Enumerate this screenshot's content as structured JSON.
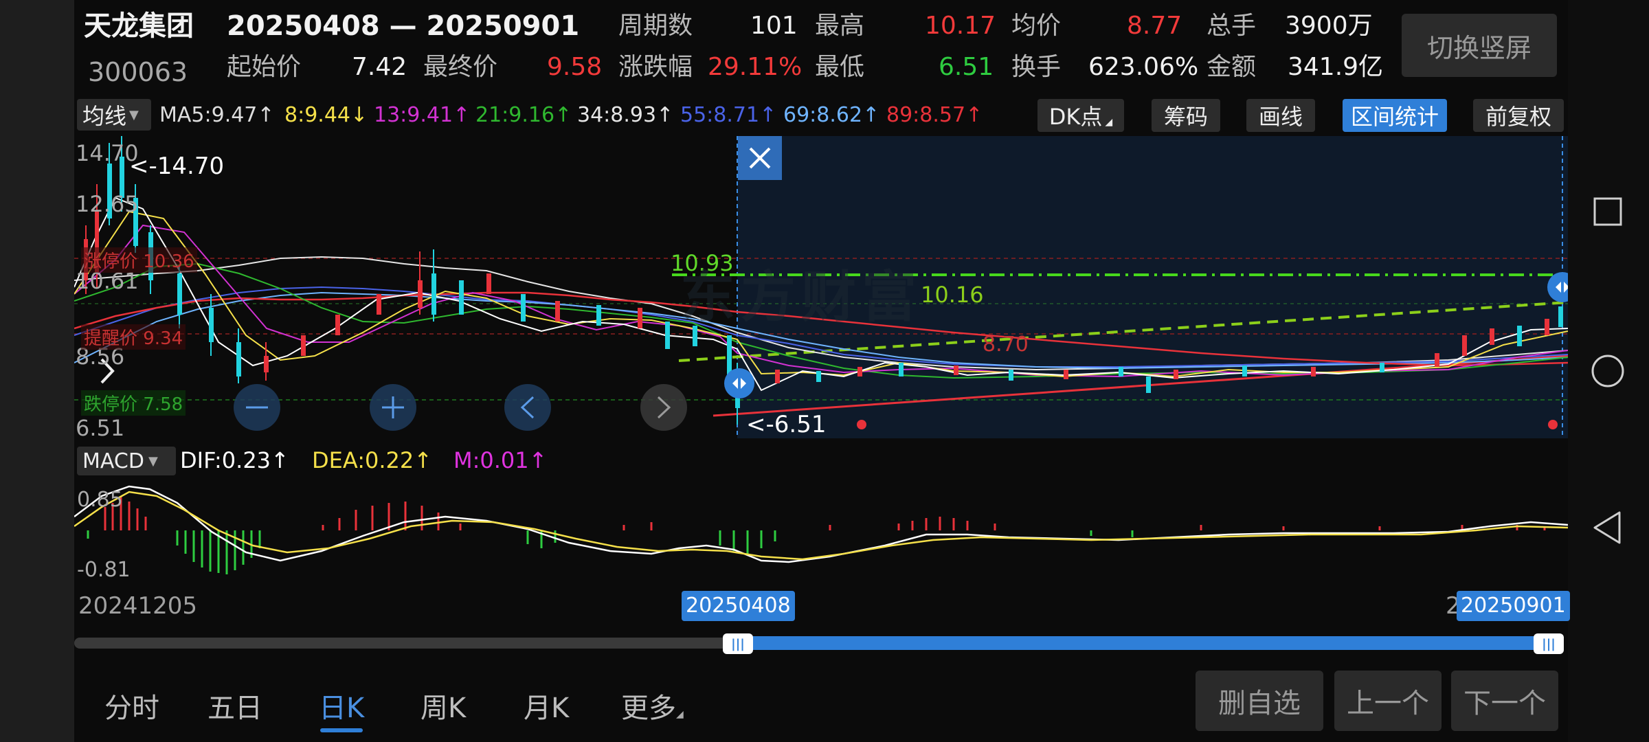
{
  "header": {
    "stock_name": "天龙集团",
    "date_range": "20250408 — 20250901",
    "stock_code": "300063",
    "stats_row1": [
      {
        "label": "周期数",
        "value": "101"
      },
      {
        "label": "最高",
        "value": "10.17"
      },
      {
        "label": "均价",
        "value": "8.77"
      },
      {
        "label": "总手",
        "value": "3900万"
      }
    ],
    "stats_row2": [
      {
        "label": "起始价",
        "value": "7.42"
      },
      {
        "label": "最终价",
        "value": "9.58"
      },
      {
        "label": "涨跌幅",
        "value": "29.11%"
      },
      {
        "label": "最低",
        "value": "6.51"
      },
      {
        "label": "换手",
        "value": "623.06%"
      },
      {
        "label": "金额",
        "value": "341.9亿"
      }
    ],
    "switch_button": "切换竖屏"
  },
  "toolbar": {
    "indicator_select": "均线",
    "ma_items": [
      {
        "text": "MA5:9.47↑",
        "color": "#ffffff"
      },
      {
        "text": "8:9.44↓",
        "color": "#f5e04a"
      },
      {
        "text": "13:9.41↑",
        "color": "#d232d2"
      },
      {
        "text": "21:9.16↑",
        "color": "#2fb82f"
      },
      {
        "text": "34:8.93↑",
        "color": "#e6e6e6"
      },
      {
        "text": "55:8.71↑",
        "color": "#4a63e8"
      },
      {
        "text": "69:8.62↑",
        "color": "#6fb4ff"
      },
      {
        "text": "89:8.57↑",
        "color": "#e8323a"
      }
    ],
    "buttons": [
      "DK点",
      "筹码",
      "画线",
      "区间统计",
      "前复权"
    ]
  },
  "price_chart": {
    "y_labels": [
      "14.70",
      "12.65",
      "10.61",
      "8.56",
      "6.51"
    ],
    "high_marker": "<-14.70",
    "low_marker": "<-6.51",
    "limit_up_label": "涨停价 10.36",
    "reminder_label": "提醒价 9.34",
    "limit_down_label": "跌停价 7.58",
    "line_label_1": "10.93",
    "line_label_2": "10.16",
    "line_label_3": "8.70",
    "watermark": "东方财富",
    "close_icon": "×"
  },
  "macd": {
    "selector": "MACD",
    "dif": "DIF:0.23↑",
    "dea": "DEA:0.22↑",
    "m": "M:0.01↑",
    "y_top": "0.85",
    "y_bottom": "-0.81"
  },
  "range_slider": {
    "start_date": "20241205",
    "sel_start": "20250408",
    "sel_end": "20250901",
    "end_partial": "2"
  },
  "bottom_tabs": [
    "分时",
    "五日",
    "日K",
    "周K",
    "月K",
    "更多"
  ],
  "bottom_buttons": [
    "删自选",
    "上一个",
    "下一个"
  ],
  "colors": {
    "accent": "#2f7fd8",
    "up": "#f23a3a",
    "down": "#2ecc40",
    "candle_down": "#22d3e0"
  }
}
